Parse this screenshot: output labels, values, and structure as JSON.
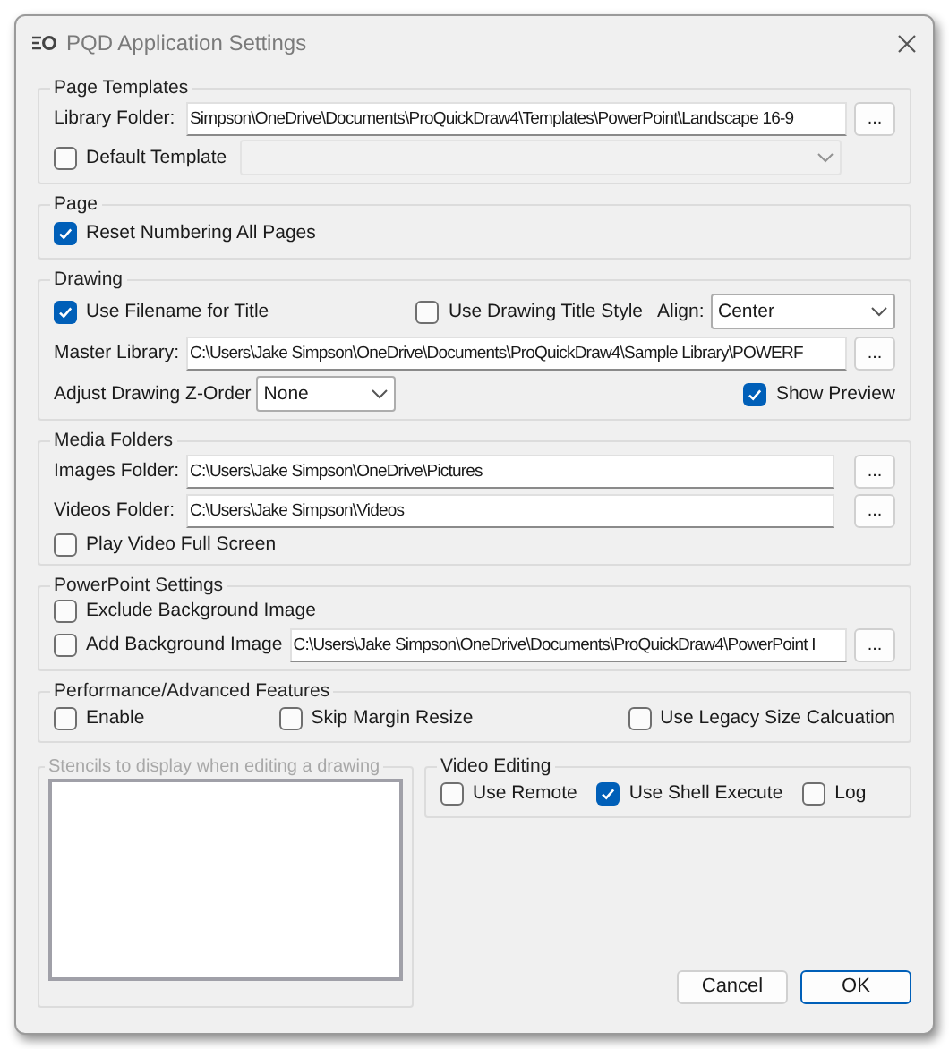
{
  "window": {
    "title": "PQD Application Settings"
  },
  "page_templates": {
    "title": "Page Templates",
    "library_folder": {
      "label": "Library Folder:",
      "value": "Simpson\\OneDrive\\Documents\\ProQuickDraw4\\Templates\\PowerPoint\\Landscape 16-9",
      "browse": "..."
    },
    "default_template": {
      "label": "Default Template",
      "checked": false
    },
    "template_select": {
      "disabled": true
    }
  },
  "page": {
    "title": "Page",
    "reset_numbering": {
      "label": "Reset Numbering All Pages",
      "checked": true
    }
  },
  "drawing": {
    "title": "Drawing",
    "use_filename": {
      "label": "Use Filename for Title",
      "checked": true
    },
    "use_title_style": {
      "label": "Use Drawing Title Style",
      "checked": false
    },
    "align": {
      "label": "Align:",
      "value": "Center"
    },
    "master_library": {
      "label": "Master Library:",
      "value": "C:\\Users\\Jake Simpson\\OneDrive\\Documents\\ProQuickDraw4\\Sample Library\\POWERF",
      "browse": "..."
    },
    "z_order": {
      "label": "Adjust Drawing Z-Order",
      "value": "None"
    },
    "show_preview": {
      "label": "Show Preview",
      "checked": true
    }
  },
  "media_folders": {
    "title": "Media Folders",
    "images_folder": {
      "label": "Images Folder:",
      "value": "C:\\Users\\Jake Simpson\\OneDrive\\Pictures",
      "browse": "..."
    },
    "videos_folder": {
      "label": "Videos Folder:",
      "value": "C:\\Users\\Jake Simpson\\Videos",
      "browse": "..."
    },
    "play_full_screen": {
      "label": "Play Video Full Screen",
      "checked": false
    }
  },
  "powerpoint_settings": {
    "title": "PowerPoint Settings",
    "exclude_background": {
      "label": "Exclude Background Image",
      "checked": false
    },
    "add_background": {
      "label": "Add Background Image",
      "checked": false
    },
    "background_path": {
      "value": "C:\\Users\\Jake Simpson\\OneDrive\\Documents\\ProQuickDraw4\\PowerPoint I",
      "browse": "..."
    }
  },
  "performance": {
    "title": "Performance/Advanced Features",
    "options": [
      {
        "label": "Enable",
        "checked": false
      },
      {
        "label": "Skip Margin Resize",
        "checked": false
      },
      {
        "label": "Use Legacy Size Calcuation",
        "checked": false
      }
    ]
  },
  "stencils": {
    "title": "Stencils to display when editing a drawing",
    "disabled": true
  },
  "video_editing": {
    "title": "Video Editing",
    "options": [
      {
        "label": "Use Remote",
        "checked": false
      },
      {
        "label": "Use Shell Execute",
        "checked": true
      },
      {
        "label": "Log",
        "checked": false
      }
    ]
  },
  "buttons": [
    {
      "label": "Cancel",
      "default": false
    },
    {
      "label": "OK",
      "default": true
    }
  ]
}
